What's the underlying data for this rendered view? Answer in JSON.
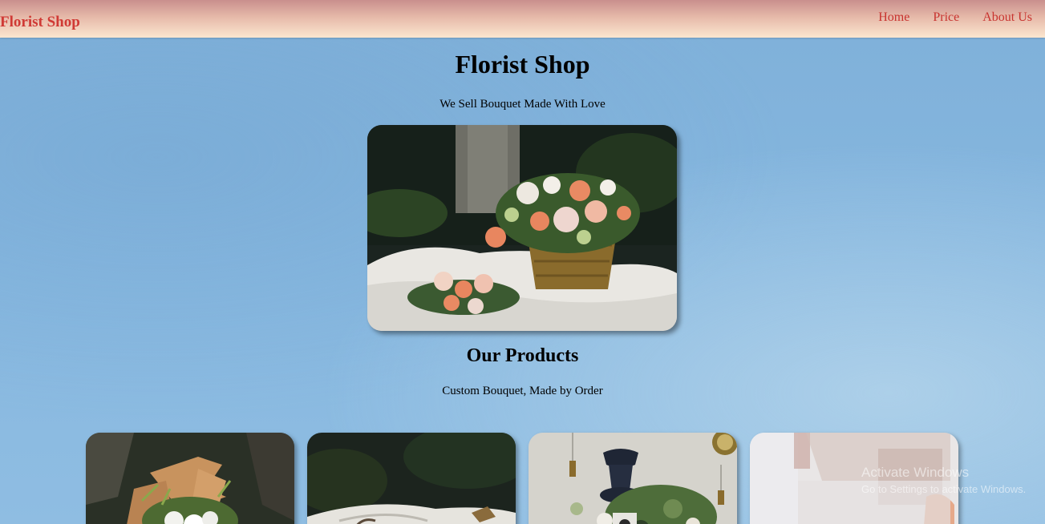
{
  "navbar": {
    "brand": "Florist Shop",
    "links": [
      {
        "label": "Home"
      },
      {
        "label": "Price"
      },
      {
        "label": "About Us"
      }
    ]
  },
  "hero": {
    "title": "Florist Shop",
    "subtitle": "We Sell Bouquet Made With Love",
    "image_icon": "flower-basket-photo"
  },
  "products": {
    "title": "Our Products",
    "subtitle": "Custom Bouquet, Made by Order",
    "cards": [
      {
        "image_icon": "paper-wrapped-bouquet-photo"
      },
      {
        "image_icon": "dark-bouquet-photo"
      },
      {
        "image_icon": "vase-arrangement-photo"
      },
      {
        "image_icon": "blurred-bouquet-photo"
      }
    ]
  },
  "watermark": {
    "line1": "Activate Windows",
    "line2": "Go to Settings to activate Windows."
  },
  "colors": {
    "brand": "#d03a35",
    "nav_link": "#c8332f",
    "background": "#86b7df"
  }
}
